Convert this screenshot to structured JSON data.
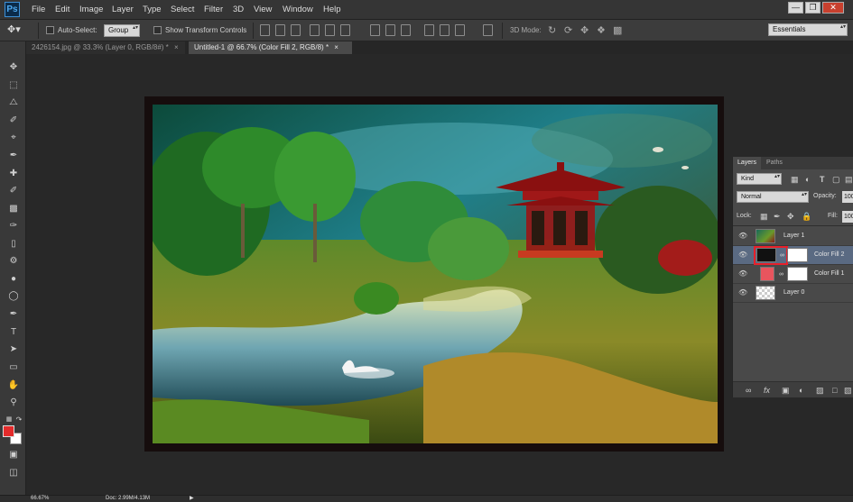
{
  "app": {
    "logo": "Ps"
  },
  "menu": [
    "File",
    "Edit",
    "Image",
    "Layer",
    "Type",
    "Select",
    "Filter",
    "3D",
    "View",
    "Window",
    "Help"
  ],
  "window_controls": {
    "minimize": "—",
    "restore": "❐",
    "close": "✕"
  },
  "options_bar": {
    "auto_select_label": "Auto-Select:",
    "auto_select_value": "Group",
    "show_transform_label": "Show Transform Controls",
    "mode_3d_label": "3D Mode:",
    "workspace": "Essentials"
  },
  "tabs": [
    {
      "label": "2426154.jpg @ 33.3% (Layer 0, RGB/8#) *",
      "close": "×",
      "active": false
    },
    {
      "label": "Untitled-1 @ 66.7% (Color Fill 2, RGB/8) *",
      "close": "×",
      "active": true
    }
  ],
  "colors": {
    "foreground": "#e42b2b",
    "background": "#ffffff",
    "highlight": "#e8202a",
    "color_fill_1": "#e8555e"
  },
  "layers_panel": {
    "tabs": [
      "Layers",
      "Paths"
    ],
    "filter_kind": "Kind",
    "blend_mode": "Normal",
    "opacity_label": "Opacity:",
    "opacity_value": "100",
    "lock_label": "Lock:",
    "fill_label": "Fill:",
    "fill_value": "100",
    "layers": [
      {
        "name": "Layer 1"
      },
      {
        "name": "Color Fill 2"
      },
      {
        "name": "Color Fill 1"
      },
      {
        "name": "Layer 0"
      }
    ],
    "footer_icons": [
      "link-icon",
      "fx-icon",
      "mask-icon",
      "adjustment-icon",
      "group-icon",
      "new-layer-icon",
      "trash-icon"
    ]
  },
  "status": {
    "zoom": "66.67%",
    "doc_info": "Doc: 2.99M/4.13M"
  }
}
